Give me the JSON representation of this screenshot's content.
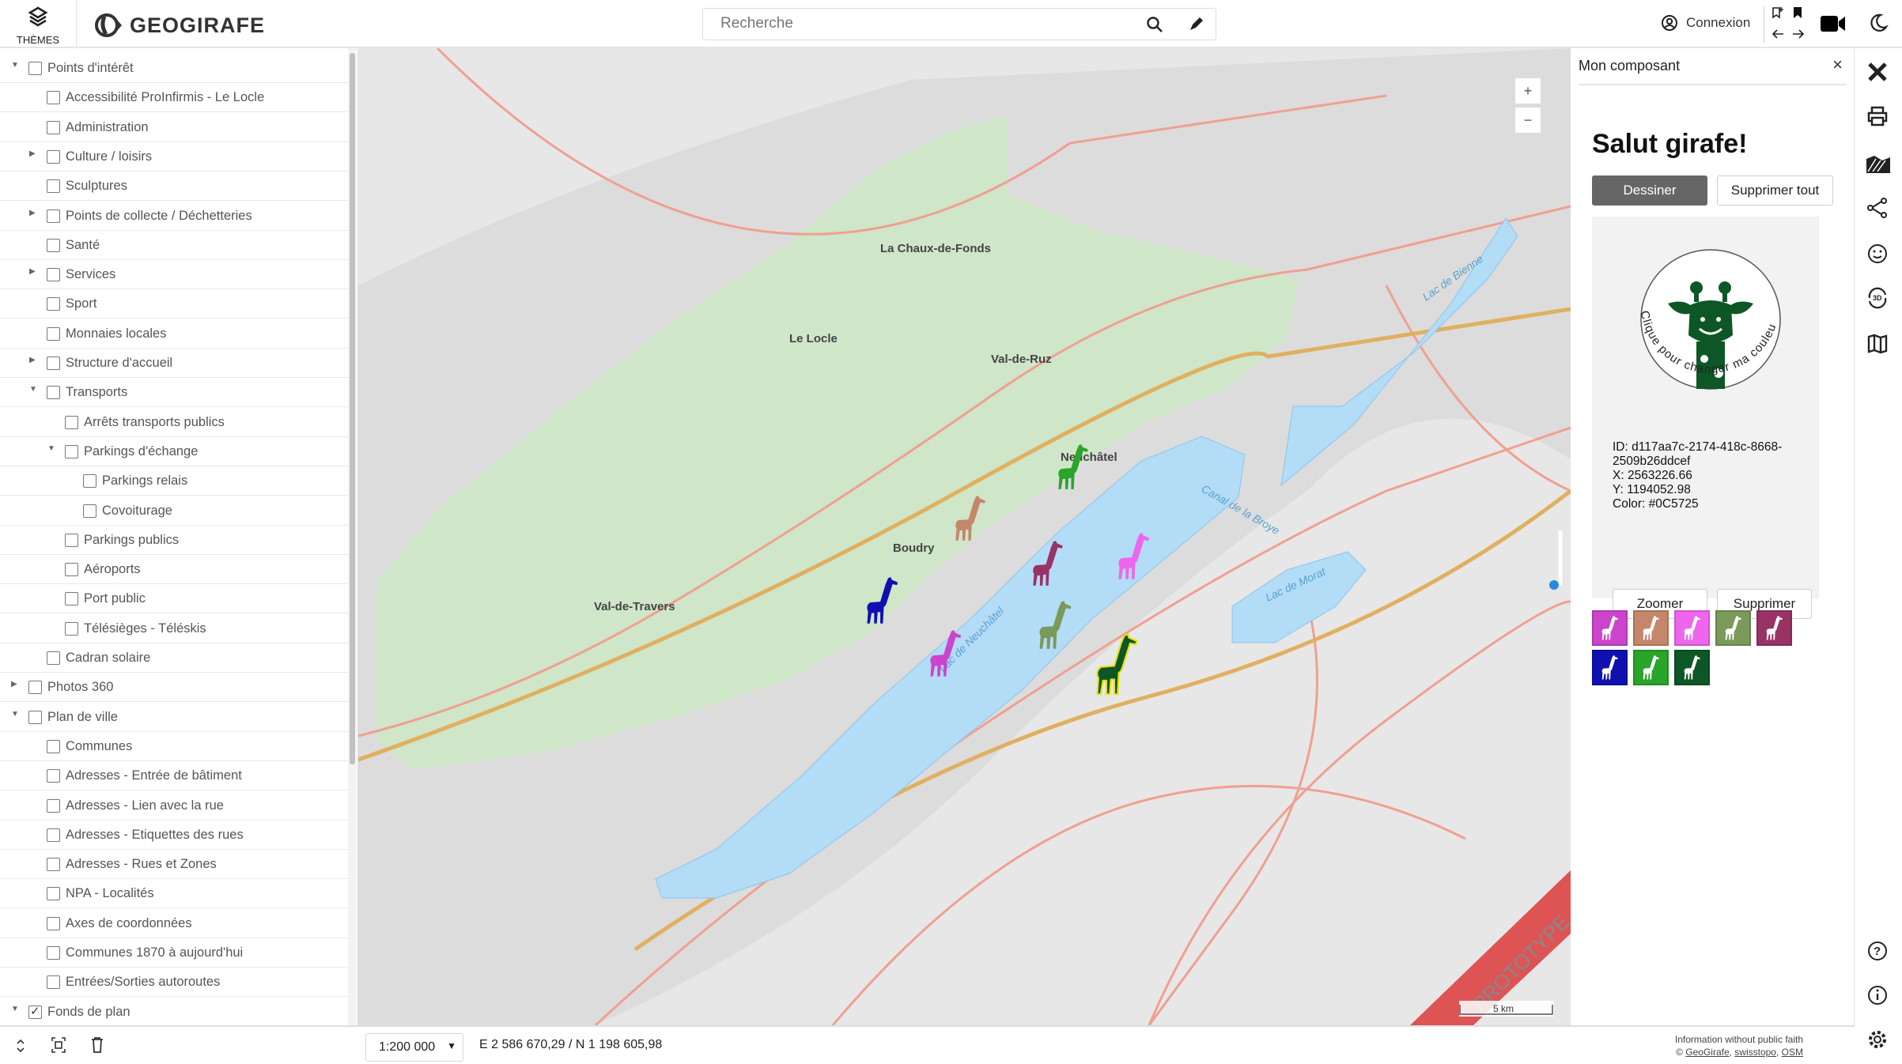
{
  "header": {
    "themes_label": "THÈMES",
    "logo_text": "GEOGIRAFE",
    "search_placeholder": "Recherche",
    "login_label": "Connexion"
  },
  "tree": [
    {
      "label": "Points d'intérêt",
      "level": 0,
      "expander": "expanded",
      "checked": false
    },
    {
      "label": "Accessibilité ProInfirmis - Le Locle",
      "level": 1,
      "expander": "none",
      "checked": false
    },
    {
      "label": "Administration",
      "level": 1,
      "expander": "none",
      "checked": false
    },
    {
      "label": "Culture / loisirs",
      "level": 1,
      "expander": "collapsed",
      "checked": false
    },
    {
      "label": "Sculptures",
      "level": 1,
      "expander": "none",
      "checked": false
    },
    {
      "label": "Points de collecte / Déchetteries",
      "level": 1,
      "expander": "collapsed",
      "checked": false
    },
    {
      "label": "Santé",
      "level": 1,
      "expander": "none",
      "checked": false
    },
    {
      "label": "Services",
      "level": 1,
      "expander": "collapsed",
      "checked": false
    },
    {
      "label": "Sport",
      "level": 1,
      "expander": "none",
      "checked": false
    },
    {
      "label": "Monnaies locales",
      "level": 1,
      "expander": "none",
      "checked": false
    },
    {
      "label": "Structure d'accueil",
      "level": 1,
      "expander": "collapsed",
      "checked": false
    },
    {
      "label": "Transports",
      "level": 1,
      "expander": "expanded",
      "checked": false
    },
    {
      "label": "Arrêts transports publics",
      "level": 2,
      "expander": "none",
      "checked": false
    },
    {
      "label": "Parkings d'échange",
      "level": 2,
      "expander": "expanded",
      "checked": false
    },
    {
      "label": "Parkings relais",
      "level": 3,
      "expander": "none",
      "checked": false
    },
    {
      "label": "Covoiturage",
      "level": 3,
      "expander": "none",
      "checked": false
    },
    {
      "label": "Parkings publics",
      "level": 2,
      "expander": "none",
      "checked": false
    },
    {
      "label": "Aéroports",
      "level": 2,
      "expander": "none",
      "checked": false
    },
    {
      "label": "Port public",
      "level": 2,
      "expander": "none",
      "checked": false
    },
    {
      "label": "Télésièges - Téléskis",
      "level": 2,
      "expander": "none",
      "checked": false
    },
    {
      "label": "Cadran solaire",
      "level": 1,
      "expander": "none",
      "checked": false
    },
    {
      "label": "Photos 360",
      "level": 0,
      "expander": "collapsed",
      "checked": false
    },
    {
      "label": "Plan de ville",
      "level": 0,
      "expander": "expanded",
      "checked": false
    },
    {
      "label": "Communes",
      "level": 1,
      "expander": "none",
      "checked": false
    },
    {
      "label": "Adresses - Entrée de bâtiment",
      "level": 1,
      "expander": "none",
      "checked": false
    },
    {
      "label": "Adresses - Lien avec la rue",
      "level": 1,
      "expander": "none",
      "checked": false
    },
    {
      "label": "Adresses - Etiquettes des rues",
      "level": 1,
      "expander": "none",
      "checked": false
    },
    {
      "label": "Adresses - Rues et Zones",
      "level": 1,
      "expander": "none",
      "checked": false
    },
    {
      "label": "NPA - Localités",
      "level": 1,
      "expander": "none",
      "checked": false
    },
    {
      "label": "Axes de coordonnées",
      "level": 1,
      "expander": "none",
      "checked": false
    },
    {
      "label": "Communes 1870 à aujourd'hui",
      "level": 1,
      "expander": "none",
      "checked": false
    },
    {
      "label": "Entrées/Sorties autoroutes",
      "level": 1,
      "expander": "none",
      "checked": false
    },
    {
      "label": "Fonds de plan",
      "level": 0,
      "expander": "expanded",
      "checked": true
    }
  ],
  "map": {
    "labels": {
      "chaux_de_fonds": "La Chaux-de-Fonds",
      "le_locle": "Le Locle",
      "val_de_ruz": "Val-de-Ruz",
      "neuchatel": "Neuchâtel",
      "boudry": "Boudry",
      "val_de_travers": "Val-de-Travers",
      "lac_neuchatel": "Lac de Neuchâtel",
      "lac_bienne": "Lac de Bienne",
      "lac_morat": "Lac de Morat",
      "canal_broye": "Canal de la Broye"
    },
    "zoom_in": "+",
    "zoom_out": "−",
    "banner": "PROTOTYPE",
    "scalebar": "5 km",
    "colors": {
      "lake": "#b3dcf7",
      "forest": "#cfe6c8",
      "background": "#e7e7e7",
      "road": "#f0a090"
    },
    "markers": [
      "#2aa52a",
      "#c4876a",
      "#993366",
      "#ee66ee",
      "#1010b0",
      "#cc44cc",
      "#7a9a5a",
      "#0c5725"
    ]
  },
  "footer": {
    "scale": "1:200 000",
    "coords": "E 2 586 670,29 / N 1 198 605,98",
    "attribution_line1": "Information without public faith",
    "attribution_prefix": "©",
    "links": [
      "GeoGirafe",
      "swisstopo",
      "OSM"
    ]
  },
  "panel": {
    "title": "Mon composant",
    "heading": "Salut girafe!",
    "draw_label": "Dessiner",
    "delete_all_label": "Supprimer tout",
    "circle_text": "Clique pour changer ma couleur!",
    "giraffe_color": "#0C5725",
    "info": {
      "id": "ID: d117aa7c-2174-418c-8668-2509b26ddcef",
      "x": "X: 2563226.66",
      "y": "Y: 1194052.98",
      "color": "Color: #0C5725"
    },
    "zoom_label": "Zoomer",
    "delete_label": "Supprimer",
    "swatches": [
      "#cc44cc",
      "#c4876a",
      "#ee66ee",
      "#7a9a5a",
      "#993366",
      "#1010b0",
      "#2aa52a",
      "#0c5725"
    ]
  }
}
